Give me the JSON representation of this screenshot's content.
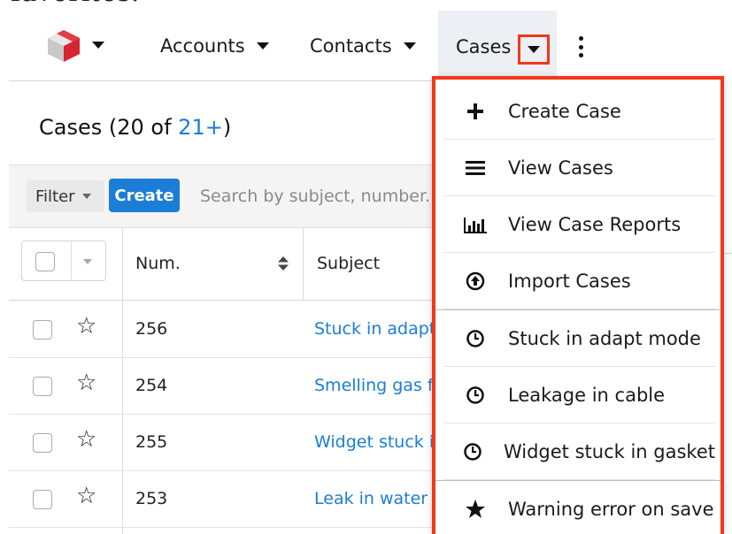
{
  "top_fragment": "favorites.",
  "nav": {
    "logo_icon": "sugar-cube-icon",
    "items": [
      {
        "label": "Accounts"
      },
      {
        "label": "Contacts"
      }
    ],
    "active_tab": {
      "label": "Cases"
    }
  },
  "list": {
    "title_prefix": "Cases (20 of ",
    "title_count_link": "21+",
    "title_suffix": ")",
    "filter_label": "Filter",
    "create_label": "Create",
    "search_placeholder": "Search by subject, number...",
    "columns": {
      "num": "Num.",
      "subject": "Subject"
    },
    "rows": [
      {
        "num": "256",
        "subject": "Stuck in adapt mode"
      },
      {
        "num": "254",
        "subject": "Smelling gas from the unit"
      },
      {
        "num": "255",
        "subject": "Widget stuck in gasket"
      },
      {
        "num": "253",
        "subject": "Leak in water line"
      }
    ]
  },
  "menu": {
    "items": [
      {
        "label": "Create Case",
        "icon": "plus-icon"
      },
      {
        "label": "View Cases",
        "icon": "list-icon"
      },
      {
        "label": "View Case Reports",
        "icon": "bar-chart-icon"
      },
      {
        "label": "Import Cases",
        "icon": "import-icon"
      },
      {
        "label": "Stuck in adapt mode",
        "icon": "clock-icon"
      },
      {
        "label": "Leakage in cable",
        "icon": "clock-icon"
      },
      {
        "label": "Widget stuck in gasket",
        "icon": "clock-icon"
      },
      {
        "label": "Warning error on save",
        "icon": "star-icon"
      }
    ]
  },
  "colors": {
    "accent_blue": "#1b7dd6",
    "highlight_red": "#f0381a"
  }
}
